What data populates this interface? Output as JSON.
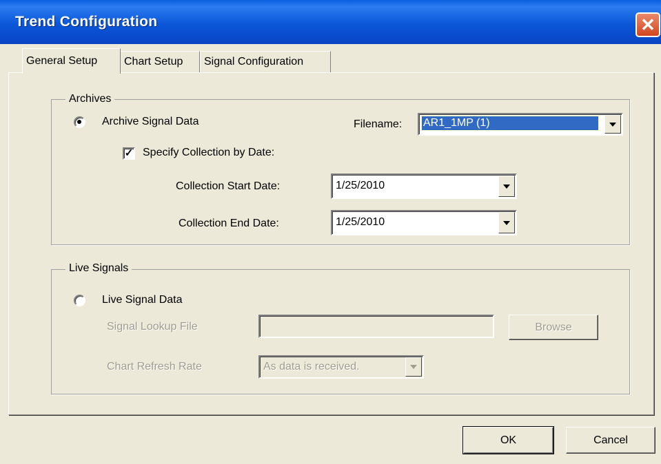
{
  "window": {
    "title": "Trend Configuration"
  },
  "tabs": [
    {
      "label": "General Setup",
      "active": true
    },
    {
      "label": "Chart Setup",
      "active": false
    },
    {
      "label": "Signal Configuration",
      "active": false
    }
  ],
  "archives": {
    "group_label": "Archives",
    "archive_radio_label": "Archive Signal Data",
    "archive_radio_checked": true,
    "filename_label": "Filename:",
    "filename_value": "AR1_1MP  (1)",
    "specify_checkbox_label": "Specify Collection by Date:",
    "specify_checked": true,
    "start_date_label": "Collection Start Date:",
    "start_date_value": "1/25/2010",
    "end_date_label": "Collection End Date:",
    "end_date_value": "1/25/2010"
  },
  "live": {
    "group_label": "Live Signals",
    "live_radio_label": "Live Signal Data",
    "live_radio_checked": false,
    "lookup_label": "Signal Lookup File",
    "lookup_value": "",
    "browse_label": "Browse",
    "refresh_label": "Chart Refresh Rate",
    "refresh_value": "As data is received."
  },
  "footer": {
    "ok_label": "OK",
    "cancel_label": "Cancel"
  },
  "icons": {
    "close": "close-icon",
    "dropdown": "chevron-down-icon"
  }
}
